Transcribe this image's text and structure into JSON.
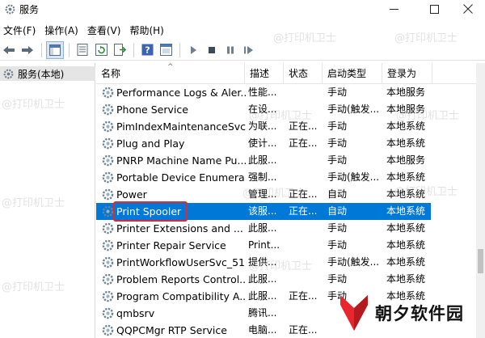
{
  "window": {
    "title": "服务"
  },
  "menu": [
    "文件(F)",
    "操作(A)",
    "查看(V)",
    "帮助(H)"
  ],
  "tree": {
    "root_label": "服务(本地)"
  },
  "columns": {
    "name": "名称",
    "desc": "描述",
    "status": "状态",
    "startup": "启动类型",
    "logon": "登录为"
  },
  "services": [
    {
      "name": "Performance Logs & Aler...",
      "desc": "性能...",
      "status": "",
      "startup": "手动",
      "logon": "本地服务"
    },
    {
      "name": "Phone Service",
      "desc": "在设...",
      "status": "",
      "startup": "手动(触发...",
      "logon": "本地服务"
    },
    {
      "name": "PimIndexMaintenanceSvc...",
      "desc": "为联...",
      "status": "正在...",
      "startup": "手动",
      "logon": "本地系统"
    },
    {
      "name": "Plug and Play",
      "desc": "使计...",
      "status": "正在...",
      "startup": "手动",
      "logon": "本地系统"
    },
    {
      "name": "PNRP Machine Name Pu...",
      "desc": "此服...",
      "status": "",
      "startup": "手动",
      "logon": "本地服务"
    },
    {
      "name": "Portable Device Enumera...",
      "desc": "强制...",
      "status": "",
      "startup": "手动(触发...",
      "logon": "本地系统"
    },
    {
      "name": "Power",
      "desc": "管理...",
      "status": "正在...",
      "startup": "自动",
      "logon": "本地系统"
    },
    {
      "name": "Print Spooler",
      "desc": "该服...",
      "status": "正在...",
      "startup": "自动",
      "logon": "本地系统"
    },
    {
      "name": "Printer Extensions and ...",
      "desc": "此服...",
      "status": "",
      "startup": "手动",
      "logon": "本地系统"
    },
    {
      "name": "Printer Repair Service",
      "desc": "Print...",
      "status": "",
      "startup": "手动",
      "logon": "本地系统"
    },
    {
      "name": "PrintWorkflowUserSvc_51...",
      "desc": "提供...",
      "status": "",
      "startup": "手动(触发...",
      "logon": "本地系统"
    },
    {
      "name": "Problem Reports Control...",
      "desc": "此服...",
      "status": "",
      "startup": "手动",
      "logon": "本地系统"
    },
    {
      "name": "Program Compatibility A...",
      "desc": "此服...",
      "status": "正在...",
      "startup": "手动",
      "logon": "本地系统"
    },
    {
      "name": "qmbsrv",
      "desc": "腾讯...",
      "status": "",
      "startup": "",
      "logon": ""
    },
    {
      "name": "QQPCMgr RTP Service",
      "desc": "电脑...",
      "status": "正在...",
      "startup": "",
      "logon": ""
    }
  ],
  "selected_service": "Print Spooler",
  "watermark": "@打印机卫士",
  "brand": {
    "text": "朝夕软件园"
  },
  "colors": {
    "selection": "#0078d7",
    "highlight_box": "#e8262b",
    "brand_logo": "#e8262b"
  }
}
